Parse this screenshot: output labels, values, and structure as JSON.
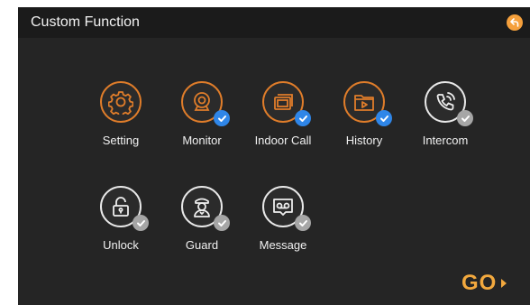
{
  "header": {
    "title": "Custom Function",
    "back_icon": "back-arrow-icon"
  },
  "tiles": [
    {
      "label": "Setting",
      "icon": "gear-icon",
      "style": "orange",
      "check": "none"
    },
    {
      "label": "Monitor",
      "icon": "camera-icon",
      "style": "orange",
      "check": "blue"
    },
    {
      "label": "Indoor Call",
      "icon": "indoor-call-icon",
      "style": "orange",
      "check": "blue"
    },
    {
      "label": "History",
      "icon": "folder-icon",
      "style": "orange",
      "check": "blue"
    },
    {
      "label": "Intercom",
      "icon": "phone-icon",
      "style": "white",
      "check": "grey"
    },
    {
      "label": "Unlock",
      "icon": "unlock-icon",
      "style": "white",
      "check": "grey"
    },
    {
      "label": "Guard",
      "icon": "guard-icon",
      "style": "white",
      "check": "grey"
    },
    {
      "label": "Message",
      "icon": "voicemail-icon",
      "style": "white",
      "check": "grey"
    }
  ],
  "go": {
    "label": "GO"
  },
  "colors": {
    "accent_orange": "#e07d2a",
    "check_blue": "#2f86e8",
    "check_grey": "#a6a6a6",
    "background": "#252525",
    "header_bg": "#1b1b1b"
  }
}
